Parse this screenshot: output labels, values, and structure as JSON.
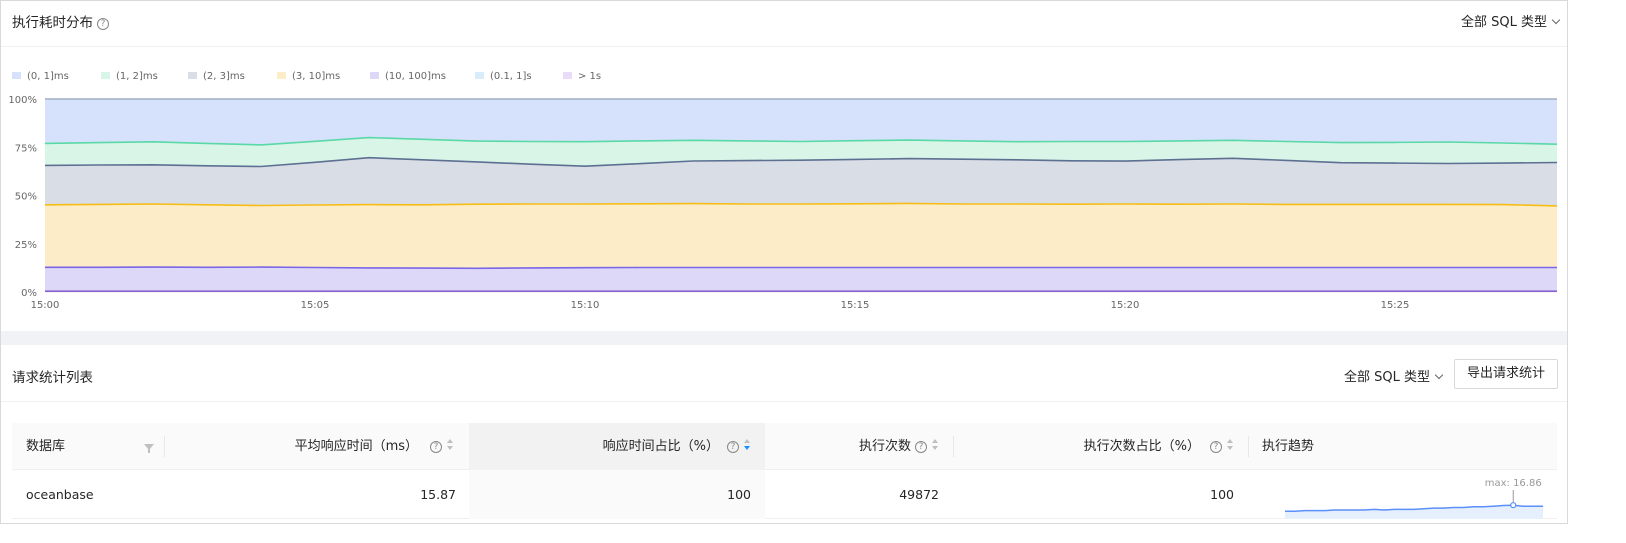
{
  "top_card": {
    "title": "执行耗时分布",
    "help": "?",
    "sql_type_select": "全部 SQL 类型"
  },
  "colors": {
    "bucket_0_1ms": "#d6e2fb",
    "bucket_1_2ms": "#d8f5e8",
    "bucket_2_3ms": "#d9dde6",
    "bucket_3_10ms": "#fcecc8",
    "bucket_10_100ms": "#ddd8f7",
    "bucket_01_1s": "#d8ecfa",
    "bucket_gt_1s": "#e8dcf8",
    "line_75": "#5ad8a6",
    "line_65": "#5d7092",
    "line_45": "#f6bd16",
    "line_12": "#7a66e6",
    "accent": "#1890ff"
  },
  "chart_data": {
    "type": "area",
    "stacked": true,
    "percent": true,
    "x": [
      "15:00",
      "15:01",
      "15:02",
      "15:03",
      "15:04",
      "15:05",
      "15:06",
      "15:07",
      "15:08",
      "15:09",
      "15:10",
      "15:11",
      "15:12",
      "15:13",
      "15:14",
      "15:15",
      "15:16",
      "15:17",
      "15:18",
      "15:19",
      "15:20",
      "15:21",
      "15:22",
      "15:23",
      "15:24",
      "15:25",
      "15:26",
      "15:27",
      "15:28"
    ],
    "x_ticks": [
      "15:00",
      "15:05",
      "15:10",
      "15:15",
      "15:20",
      "15:25"
    ],
    "y_ticks": [
      "0%",
      "25%",
      "50%",
      "75%",
      "100%"
    ],
    "ylim": [
      0,
      100
    ],
    "legend_position": "top-left",
    "legend": [
      "(0, 1]ms",
      "(1, 2]ms",
      "(2, 3]ms",
      "(3, 10]ms",
      "(10, 100]ms",
      "(0.1, 1]s",
      "> 1s"
    ],
    "cumulative_series": [
      {
        "name": "(10, 100]ms",
        "values": [
          12.8,
          12.8,
          12.9,
          12.8,
          12.9,
          12.7,
          12.5,
          12.4,
          12.3,
          12.5,
          12.6,
          12.7,
          12.7,
          12.7,
          12.7,
          12.7,
          12.7,
          12.7,
          12.7,
          12.7,
          12.7,
          12.7,
          12.7,
          12.7,
          12.7,
          12.7,
          12.7,
          12.7,
          12.7
        ]
      },
      {
        "name": "(3, 10]ms",
        "values": [
          45.2,
          45.4,
          45.6,
          45.2,
          44.8,
          45.1,
          45.3,
          45.2,
          45.5,
          45.6,
          45.6,
          45.7,
          45.8,
          45.6,
          45.6,
          45.7,
          45.9,
          45.6,
          45.6,
          45.5,
          45.6,
          45.5,
          45.6,
          45.4,
          45.4,
          45.4,
          45.4,
          45.3,
          44.6
        ]
      },
      {
        "name": "(2, 3]ms",
        "values": [
          65.6,
          65.8,
          65.9,
          65.4,
          65.0,
          67.2,
          69.6,
          68.5,
          67.4,
          66.2,
          65.2,
          66.5,
          67.9,
          68.1,
          68.3,
          68.7,
          69.1,
          68.8,
          68.5,
          68.0,
          67.8,
          68.6,
          69.3,
          68.2,
          67.0,
          66.8,
          66.6,
          66.8,
          67.1
        ]
      },
      {
        "name": "(1, 2]ms",
        "values": [
          77.0,
          77.4,
          77.8,
          77.0,
          76.2,
          78.1,
          80.0,
          79.1,
          78.2,
          78.0,
          77.9,
          78.3,
          78.6,
          78.3,
          78.0,
          78.4,
          78.7,
          78.3,
          77.9,
          78.0,
          78.0,
          78.3,
          78.6,
          78.0,
          77.4,
          77.5,
          77.7,
          77.2,
          76.6
        ]
      },
      {
        "name": "(0, 1]ms",
        "values": [
          100,
          100,
          100,
          100,
          100,
          100,
          100,
          100,
          100,
          100,
          100,
          100,
          100,
          100,
          100,
          100,
          100,
          100,
          100,
          100,
          100,
          100,
          100,
          100,
          100,
          100,
          100,
          100,
          100
        ]
      }
    ]
  },
  "bottom_card": {
    "title": "请求统计列表",
    "sql_type_select": "全部 SQL 类型",
    "export_button": "导出请求统计"
  },
  "table": {
    "columns": [
      "数据库",
      "平均响应时间（ms）",
      "响应时间占比（%）",
      "执行次数",
      "执行次数占比（%）",
      "执行趋势"
    ],
    "rows": [
      {
        "database": "oceanbase",
        "avg_response": "15.87",
        "response_pct": "100",
        "exec_count": "49872",
        "exec_pct": "100",
        "trend_max": "max: 16.86"
      }
    ],
    "trend": [
      15.9,
      15.9,
      16.0,
      16.0,
      16.0,
      16.1,
      16.1,
      16.1,
      16.1,
      16.2,
      16.1,
      16.2,
      16.2,
      16.2,
      16.3,
      16.4,
      16.4,
      16.5,
      16.5,
      16.6,
      16.6,
      16.7,
      16.8,
      16.86,
      16.7,
      16.7,
      16.7
    ]
  }
}
